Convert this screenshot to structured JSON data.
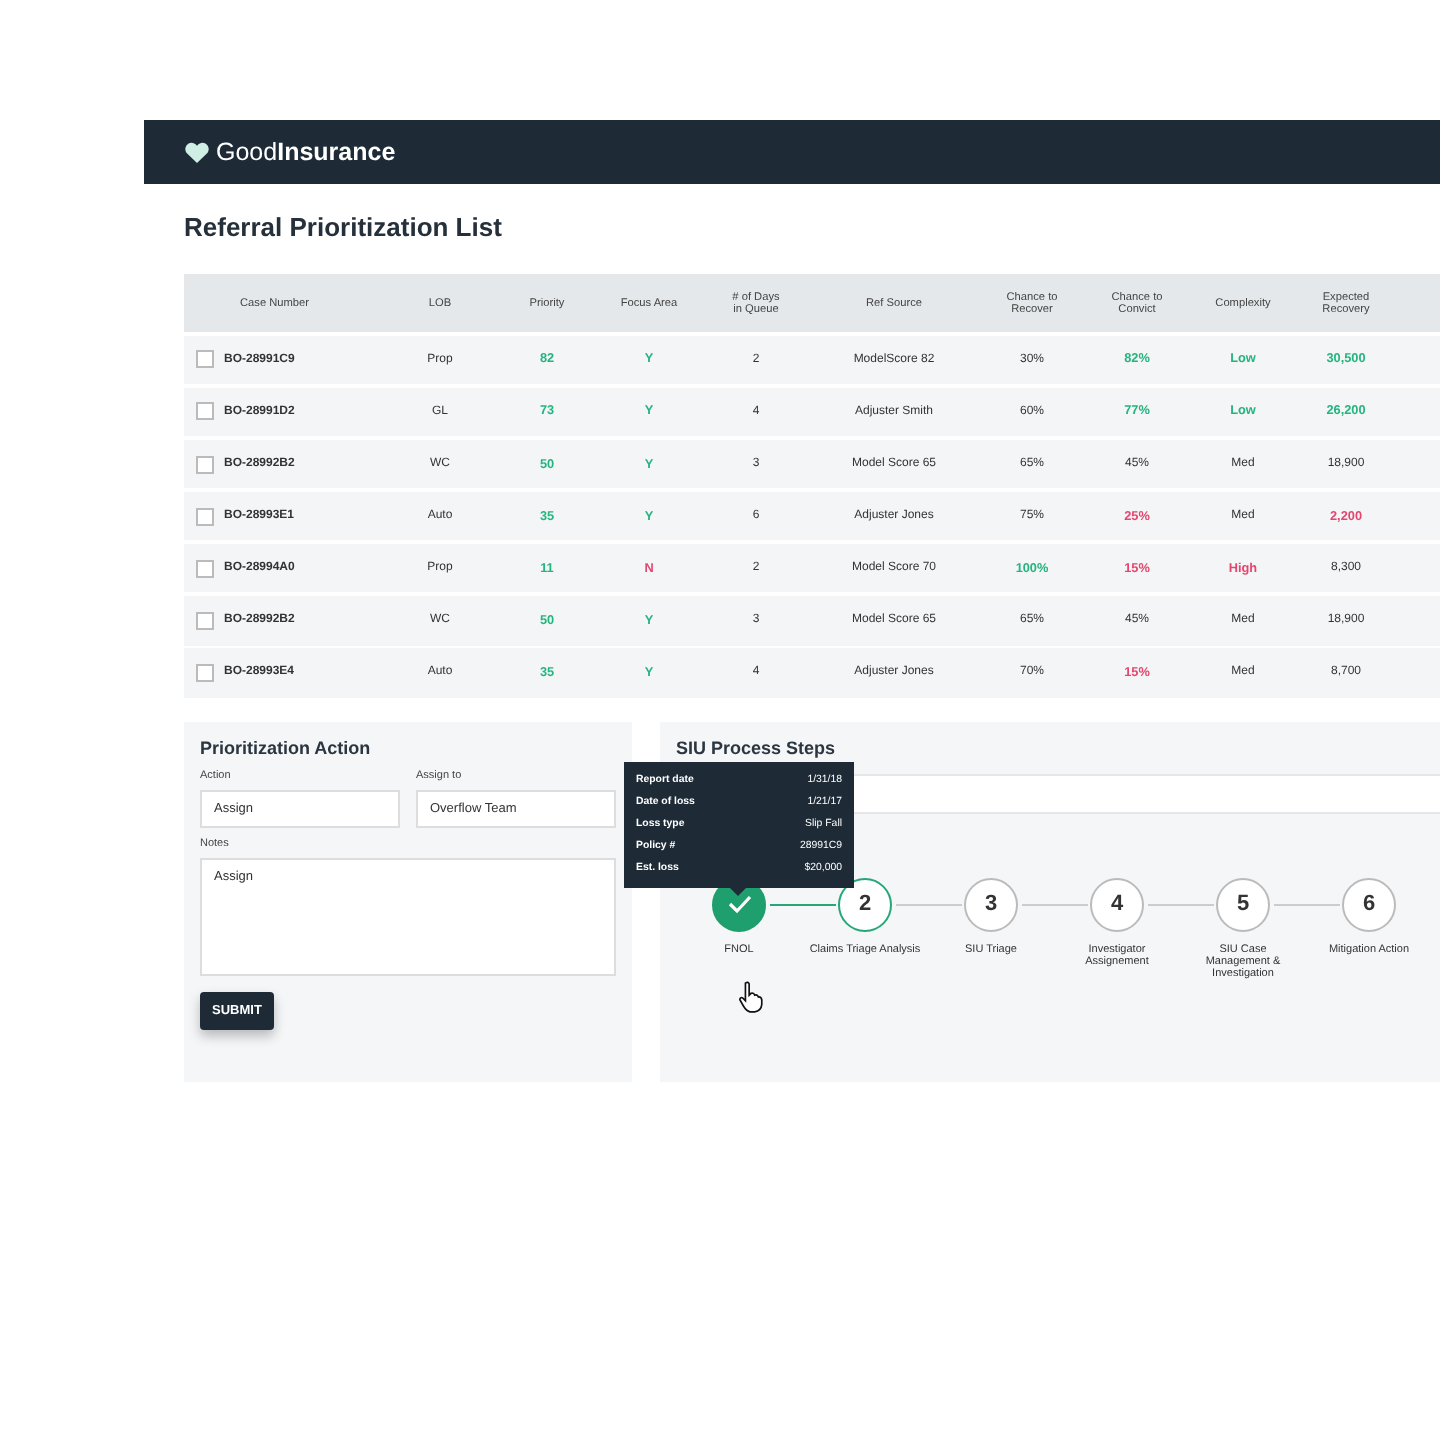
{
  "brand": "Good**Insurance**",
  "title": "Referral Prioritization List",
  "columns": [
    "Case Number",
    "LOB",
    "Priority",
    "Focus Area",
    "# of Days in Queue",
    "Ref Source",
    "Chance to Recover",
    "Chance to Convict",
    "Complexity",
    "Expected Recovery"
  ],
  "rows": [
    {
      "checked": false,
      "cells": [
        {
          "text": "BO-28991C9"
        },
        {
          "text": "Prop"
        },
        {
          "text": "82",
          "color": "#25b47e"
        },
        {
          "text": "Y",
          "color": "#25b47e"
        },
        {
          "text": "2"
        },
        {
          "text": "ModelScore 82"
        },
        {
          "text": "30%"
        },
        {
          "text": "82%",
          "color": "#25b47e"
        },
        {
          "text": "Low",
          "color": "#25b47e"
        },
        {
          "text": "30,500",
          "color": "#25b47e"
        }
      ]
    },
    {
      "checked": false,
      "cells": [
        {
          "text": "BO-28991D2"
        },
        {
          "text": "GL"
        },
        {
          "text": "73",
          "color": "#25b47e"
        },
        {
          "text": "Y",
          "color": "#25b47e"
        },
        {
          "text": "4"
        },
        {
          "text": "Adjuster Smith"
        },
        {
          "text": "60%"
        },
        {
          "text": "77%",
          "color": "#25b47e"
        },
        {
          "text": "Low",
          "color": "#25b47e"
        },
        {
          "text": "26,200",
          "color": "#25b47e"
        }
      ]
    },
    {
      "checked": false,
      "cells": [
        {
          "text": "BO-28992B2"
        },
        {
          "text": "WC"
        },
        {
          "text": "50",
          "color": "#25b47e"
        },
        {
          "text": "Y",
          "color": "#25b47e"
        },
        {
          "text": "3"
        },
        {
          "text": "Model Score 65"
        },
        {
          "text": "65%"
        },
        {
          "text": "45%"
        },
        {
          "text": "Med"
        },
        {
          "text": "18,900"
        }
      ]
    },
    {
      "checked": false,
      "cells": [
        {
          "text": "BO-28993E1"
        },
        {
          "text": "Auto"
        },
        {
          "text": "35",
          "color": "#25b47e"
        },
        {
          "text": "Y",
          "color": "#25b47e"
        },
        {
          "text": "6"
        },
        {
          "text": "Adjuster Jones"
        },
        {
          "text": "75%"
        },
        {
          "text": "25%",
          "color": "#e3476f"
        },
        {
          "text": "Med"
        },
        {
          "text": "2,200",
          "color": "#e3476f"
        }
      ]
    },
    {
      "checked": false,
      "cells": [
        {
          "text": "BO-28994A0"
        },
        {
          "text": "Prop"
        },
        {
          "text": "11",
          "color": "#25b47e"
        },
        {
          "text": "N",
          "color": "#e3476f"
        },
        {
          "text": "2"
        },
        {
          "text": "Model Score 70"
        },
        {
          "text": "100%",
          "color": "#25b47e"
        },
        {
          "text": "15%",
          "color": "#e3476f"
        },
        {
          "text": "High",
          "color": "#e3476f"
        },
        {
          "text": "8,300"
        }
      ]
    },
    {
      "checked": false,
      "cells": [
        {
          "text": "BO-28992B2"
        },
        {
          "text": "WC"
        },
        {
          "text": "50",
          "color": "#25b47e"
        },
        {
          "text": "Y",
          "color": "#25b47e"
        },
        {
          "text": "3"
        },
        {
          "text": "Model Score 65"
        },
        {
          "text": "65%"
        },
        {
          "text": "45%"
        },
        {
          "text": "Med"
        },
        {
          "text": "18,900"
        }
      ]
    },
    {
      "checked": false,
      "cells": [
        {
          "text": "BO-28993E4"
        },
        {
          "text": "Auto"
        },
        {
          "text": "35",
          "color": "#25b47e"
        },
        {
          "text": "Y",
          "color": "#25b47e"
        },
        {
          "text": "4"
        },
        {
          "text": "Adjuster Jones"
        },
        {
          "text": "70%"
        },
        {
          "text": "15%",
          "color": "#e3476f"
        },
        {
          "text": "Med"
        },
        {
          "text": "8,700"
        }
      ]
    }
  ],
  "action_panel": {
    "title": "Prioritization Action",
    "action": {
      "label": "Action",
      "value": "Assign"
    },
    "assign_to": {
      "label": "Assign to",
      "value": "Overflow Team"
    },
    "notes": {
      "label": "Notes",
      "value": "Assign"
    },
    "submit": "SUBMIT"
  },
  "steps_panel": {
    "title": "SIU Process Steps",
    "tooltip": [
      {
        "label": "Report date",
        "value": "1/31/18"
      },
      {
        "label": "Date of loss",
        "value": "1/21/17"
      },
      {
        "label": "Loss type",
        "value": "Slip Fall"
      },
      {
        "label": "Policy #",
        "value": "28991C9"
      },
      {
        "label": "Est. loss",
        "value": "$20,000"
      }
    ],
    "steps": [
      {
        "label": "FNOL",
        "completed": true,
        "selected": false
      },
      {
        "number": "2",
        "label": "Claims Triage Analysis",
        "completed": false,
        "selected": true
      },
      {
        "number": "3",
        "label": "SIU Triage",
        "completed": false,
        "selected": false
      },
      {
        "number": "4",
        "label": "Investigator Assignement",
        "completed": false,
        "selected": false
      },
      {
        "number": "5",
        "label": "SIU Case Management & Investigation",
        "completed": false,
        "selected": false
      },
      {
        "number": "6",
        "label": "Mitigation Action",
        "completed": false,
        "selected": false
      }
    ]
  }
}
